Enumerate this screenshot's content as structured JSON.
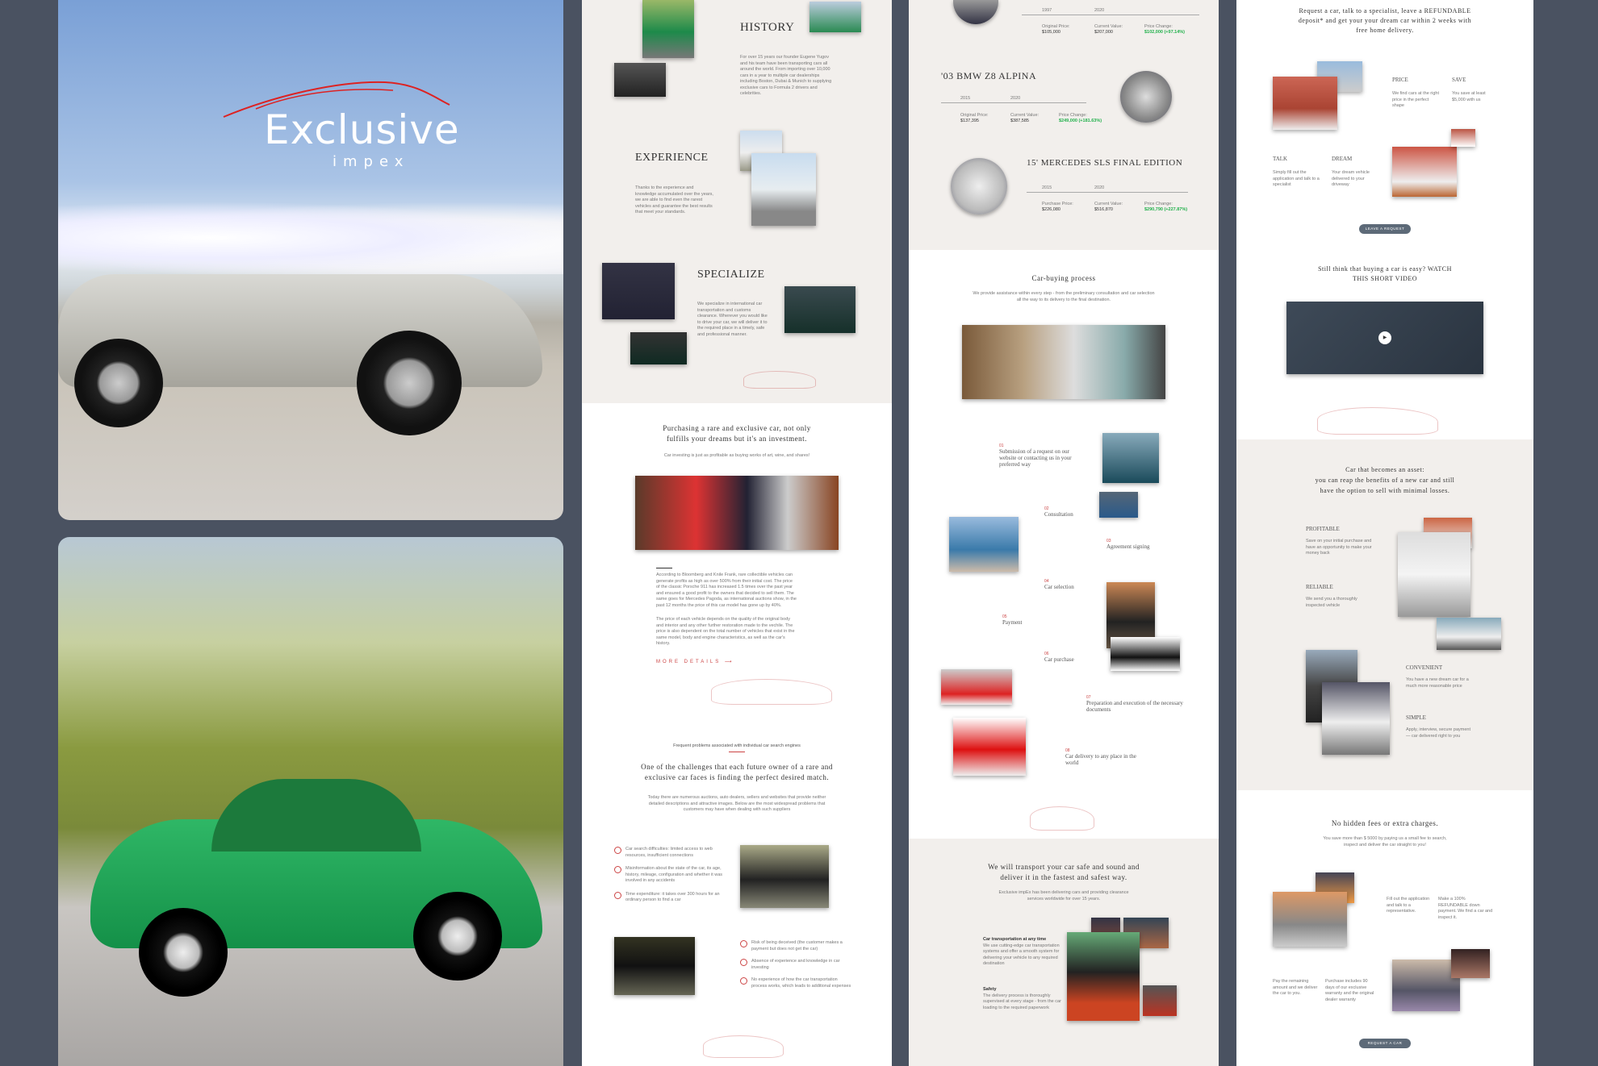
{
  "brand": {
    "main": "Exclusive",
    "sub": "impex"
  },
  "panel2": {
    "history": {
      "title": "HISTORY",
      "text": "For over 15 years our founder Eugene Yugov and his team have been transporting cars all around the world. From importing over 10,000 cars in a year to multiple car dealerships including Boston, Dubai & Munich to supplying exclusive cars to Formula 2 drivers and celebrities."
    },
    "experience": {
      "title": "EXPERIENCE",
      "text": "Thanks to the experience and knowledge accumulated over the years, we are able to find even the rarest vehicles and guarantee the best results that meet your standards."
    },
    "specialize": {
      "title": "SPECIALIZE",
      "text": "We specialize in international car transportation and customs clearance. Wherever you would like to drive your car, we will deliver it to the required place in a timely, safe and professional manner."
    },
    "invest": {
      "title1": "Purchasing a rare and exclusive car, not only",
      "title2": "fulfills your dreams but it's an investment.",
      "sub": "Car investing is just as profitable as buying works of art, wine, and shares!",
      "text1": "According to Bloomberg and Knile Frank, rare collectible vehicles can generate profits as high as over 500% from their initial cost. The price of the classic Porsche 911 has increased 1.5 times over the past year and ensured a good profit to the owners that decided to sell them. The same goes for Mercedes Pagoda, as international auctions show, in the past 12 months the price of this car model has gone up by 40%.",
      "text2": "The price of each vehicle depends on the quality of the original body and interior and any other further restoration made to the vechile. The price is also dependent on the total number of vehicles that exist in the same model, body and engine characteristics, as well as the car's history.",
      "link": "MORE DETAILS"
    },
    "problems": {
      "kicker": "Frequent problems associated with individual car search engines",
      "title1": "One of the challenges that each future owner of a rare and",
      "title2": "exclusive car faces is finding the perfect desired match.",
      "text": "Today there are numerous auctions, auto dealers, sellers and websites that provide neither detailed descriptions and attractive images. Below are the most widespread problems that customers may have when dealing with such suppliers",
      "items": [
        "Car search difficulties: limited access to web resources, insufficient connections",
        "Misinformation about the state of the car, its age, history, mileage, configuration and whether it was involved in any accidents",
        "Time expenditure: it takes over 300 hours for an ordinary person to find a car"
      ],
      "items2": [
        "Risk of being deceived (the customer makes a payment but does not get the car)",
        "Absence of experience and knowledge in car investing",
        "No experience of how the car transportation process works, which leads to additional expenses"
      ]
    }
  },
  "panel3": {
    "car1": {
      "y1": "1997",
      "y2": "2020",
      "l1": "Original Price:",
      "v1": "$105,000",
      "l2": "Current Value:",
      "v2": "$207,000",
      "l3": "Price Change:",
      "v3": "$102,000 (+97.14%)"
    },
    "car2": {
      "title": "'03 BMW Z8 ALPINA",
      "y1": "2015",
      "y2": "2020",
      "l1": "Original Price:",
      "v1": "$137,395",
      "l2": "Current Value:",
      "v2": "$387,585",
      "l3": "Price Change:",
      "v3": "$249,000 (+181.63%)"
    },
    "car3": {
      "title": "15' MERCEDES SLS FINAL EDITION",
      "y1": "2015",
      "y2": "2020",
      "l1": "Purchase Price:",
      "v1": "$226,080",
      "l2": "Current Value:",
      "v2": "$516,870",
      "l3": "Price Change:",
      "v3": "$290,790 (+227.87%)"
    },
    "process": {
      "title": "Car-buying process",
      "text": "We provide assistance within every step - from the preliminary consultation and car selection all the way to its delivery to the final destination.",
      "steps": [
        {
          "n": "01",
          "t": "Submission of a request on our website or contacting us in your preferred way"
        },
        {
          "n": "02",
          "t": "Consultation"
        },
        {
          "n": "03",
          "t": "Agreement signing"
        },
        {
          "n": "04",
          "t": "Car selection"
        },
        {
          "n": "05",
          "t": "Payment"
        },
        {
          "n": "06",
          "t": "Car purchase"
        },
        {
          "n": "07",
          "t": "Preparation and execution of the necessary documents"
        },
        {
          "n": "08",
          "t": "Car  delivery to any place in the world"
        }
      ]
    },
    "transport": {
      "title1": "We will transport your car safe and sound and",
      "title2": "deliver it in the fastest and safest way.",
      "text": "Exclusive impEx has been delivering cars and providing clearance services worldwide for over 15 years.",
      "b1": "Car transportation at any time",
      "b1t": "We use cutting-edge car transportation systems and offer a smooth system for delivering your vehicle to any required destination",
      "b2": "Safety",
      "b2t": "The delivery process is thoroughly supervised at every stage - from the car loading to the required paperwork"
    }
  },
  "panel4": {
    "intro": "Request a car, talk to a specialist, leave a REFUNDABLE deposit* and get your your dream car within 2 weeks with free home delivery.",
    "grid": [
      {
        "t": "PRICE",
        "d": "We find cars at the right price in the perfect shape"
      },
      {
        "t": "SAVE",
        "d": "You save at least $5,000 with us"
      },
      {
        "t": "TALK",
        "d": "Simply fill out the application and talk to a specialist"
      },
      {
        "t": "DREAM",
        "d": "Your dream vehicle delivered to your driveway"
      }
    ],
    "btn1": "LEAVE A REQUEST",
    "video": "Still think that buying a car is easy? WATCH THIS SHORT VIDEO",
    "asset": {
      "t1": "Car that becomes an asset:",
      "t2": "you can reap the benefits of a new car and still",
      "t3": "have the option to sell with minimal losses."
    },
    "benefits": [
      {
        "t": "PROFITABLE",
        "d": "Save on your initial purchase and have an opportunity to make your money back"
      },
      {
        "t": "RELIABLE",
        "d": "We send you a thoroughly inspected vehicle"
      },
      {
        "t": "CONVENIENT",
        "d": "You have a new dream car for a much more reasonable price"
      },
      {
        "t": "SIMPLE",
        "d": "Apply, interview, secure payment — car delivered right to you"
      }
    ],
    "fees": {
      "title": "No hidden fees or extra charges.",
      "text": "You save more than $ 5000 by paying us a small fee to search, inspect and deliver the car straight to you!",
      "s": [
        "Fill out the application and talk to a representative.",
        "Make a 100% REFUNDABLE down payment. We find a car and inspect it.",
        "Pay the remaining amount and we deliver the car to you.",
        "Purchase includes 90 days of our exclusive warranty and the original dealer warranty"
      ]
    },
    "btn2": "REQUEST A CAR"
  }
}
